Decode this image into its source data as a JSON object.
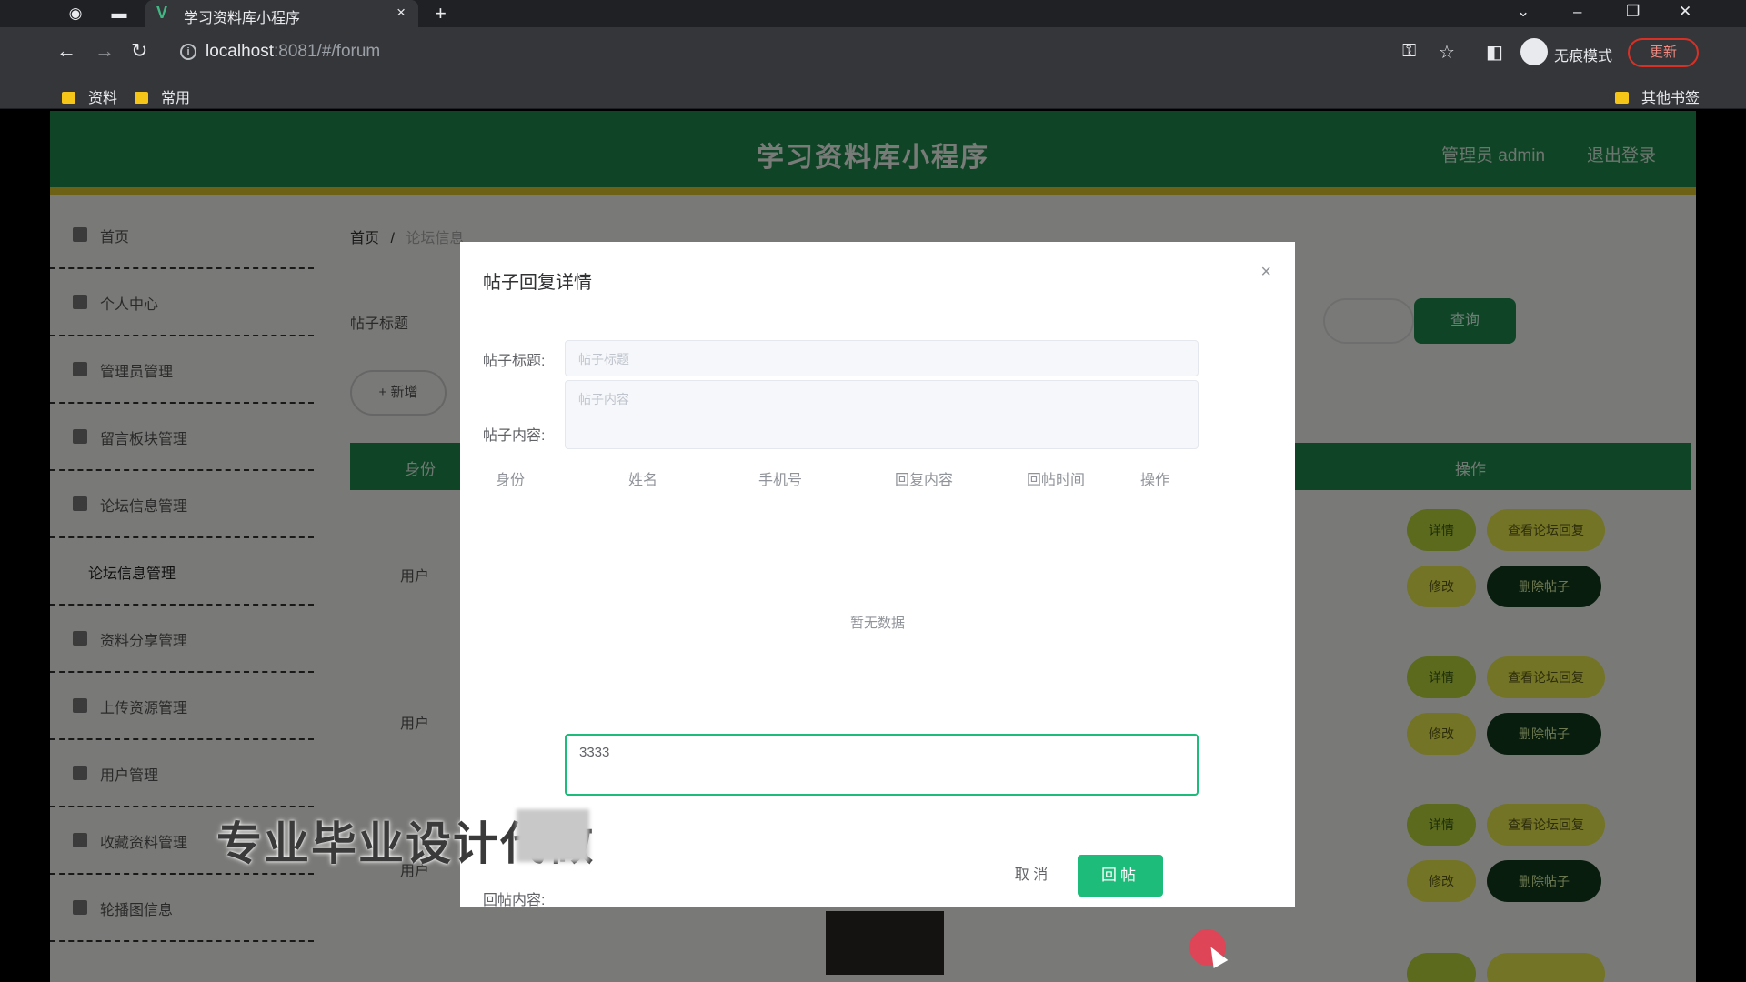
{
  "browser": {
    "tab_title": "学习资料库小程序",
    "favicon": "V",
    "close": "×",
    "new_tab": "+",
    "url_host": "localhost",
    "url_rest": ":8081/#/forum",
    "incognito_label": "无痕模式",
    "update_label": "更新",
    "bookmarks": [
      "资料",
      "常用"
    ],
    "other_bookmarks": "其他书签"
  },
  "app": {
    "title": "学习资料库小程序",
    "admin_label": "管理员 admin",
    "logout_label": "退出登录"
  },
  "sidebar": {
    "items": [
      {
        "label": "首页"
      },
      {
        "label": "个人中心"
      },
      {
        "label": "管理员管理"
      },
      {
        "label": "留言板块管理"
      },
      {
        "label": "论坛信息管理"
      },
      {
        "label": "论坛信息管理"
      },
      {
        "label": "资料分享管理"
      },
      {
        "label": "上传资源管理"
      },
      {
        "label": "用户管理"
      },
      {
        "label": "收藏资料管理"
      },
      {
        "label": "轮播图信息"
      }
    ]
  },
  "content": {
    "breadcrumb_home": "首页",
    "breadcrumb_sep": "/",
    "breadcrumb_current": "论坛信息",
    "search_label": "帖子标题",
    "search_button": "查询",
    "add_button": "+ 新增",
    "col_first": "身份",
    "col_actions": "操作",
    "rows": [
      {
        "name": "用户",
        "btn1": "详情",
        "btn2": "查看论坛回复",
        "btn3": "修改",
        "btn4": "删除帖子"
      },
      {
        "name": "用户",
        "btn1": "详情",
        "btn2": "查看论坛回复",
        "btn3": "修改",
        "btn4": "删除帖子"
      },
      {
        "name": "用户",
        "btn1": "详情",
        "btn2": "查看论坛回复",
        "btn3": "修改",
        "btn4": "删除帖子"
      }
    ]
  },
  "modal": {
    "title": "帖子回复详情",
    "close": "×",
    "post_title_label": "帖子标题:",
    "post_title_placeholder": "帖子标题",
    "post_content_label": "帖子内容:",
    "post_content_placeholder": "帖子内容",
    "columns": [
      "身份",
      "姓名",
      "手机号",
      "回复内容",
      "回帖时间",
      "操作"
    ],
    "empty_text": "暂无数据",
    "reply_label": "回帖内容:",
    "reply_value": "3333",
    "cancel_button": "取 消",
    "submit_button": "回帖"
  },
  "watermark": {
    "text": "专业毕业设计代做"
  }
}
